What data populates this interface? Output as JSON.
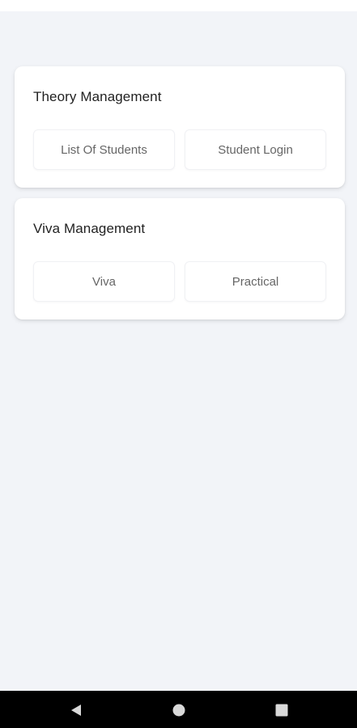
{
  "theory": {
    "title": "Theory Management",
    "buttons": [
      "List Of Students",
      "Student Login"
    ]
  },
  "viva": {
    "title": "Viva Management",
    "buttons": [
      "Viva",
      "Practical"
    ]
  },
  "nav": {
    "icons": [
      "back-icon",
      "home-icon",
      "recent-apps-icon"
    ],
    "icon_color": "#d9d9d9",
    "bar_color": "#000000"
  },
  "colors": {
    "background": "#f2f4f8",
    "card": "#ffffff",
    "title_text": "#222222",
    "button_text": "#666666"
  }
}
